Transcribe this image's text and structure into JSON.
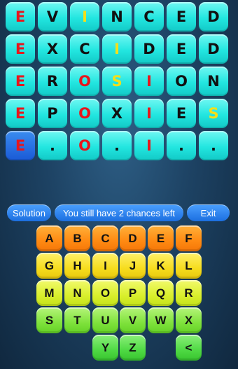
{
  "board": {
    "rows": [
      [
        {
          "ch": "E",
          "color": "red"
        },
        {
          "ch": "V",
          "color": "black"
        },
        {
          "ch": "I",
          "color": "yellow"
        },
        {
          "ch": "N",
          "color": "black"
        },
        {
          "ch": "C",
          "color": "black"
        },
        {
          "ch": "E",
          "color": "black"
        },
        {
          "ch": "D",
          "color": "black"
        }
      ],
      [
        {
          "ch": "E",
          "color": "red"
        },
        {
          "ch": "X",
          "color": "black"
        },
        {
          "ch": "C",
          "color": "black"
        },
        {
          "ch": "I",
          "color": "yellow"
        },
        {
          "ch": "D",
          "color": "black"
        },
        {
          "ch": "E",
          "color": "black"
        },
        {
          "ch": "D",
          "color": "black"
        }
      ],
      [
        {
          "ch": "E",
          "color": "red"
        },
        {
          "ch": "R",
          "color": "black"
        },
        {
          "ch": "O",
          "color": "red"
        },
        {
          "ch": "S",
          "color": "yellow"
        },
        {
          "ch": "I",
          "color": "red"
        },
        {
          "ch": "O",
          "color": "black"
        },
        {
          "ch": "N",
          "color": "black"
        }
      ],
      [
        {
          "ch": "E",
          "color": "red"
        },
        {
          "ch": "P",
          "color": "black"
        },
        {
          "ch": "O",
          "color": "red"
        },
        {
          "ch": "X",
          "color": "black"
        },
        {
          "ch": "I",
          "color": "red"
        },
        {
          "ch": "E",
          "color": "black"
        },
        {
          "ch": "S",
          "color": "yellow"
        }
      ],
      [
        {
          "ch": "E",
          "color": "red",
          "cursor": true
        },
        {
          "ch": ".",
          "color": "black"
        },
        {
          "ch": "O",
          "color": "red"
        },
        {
          "ch": ".",
          "color": "black"
        },
        {
          "ch": "I",
          "color": "red"
        },
        {
          "ch": ".",
          "color": "black"
        },
        {
          "ch": ".",
          "color": "black"
        }
      ]
    ]
  },
  "toolbar": {
    "solution_label": "Solution",
    "chances_text": "You still have 2 chances left",
    "exit_label": "Exit"
  },
  "keyboard": {
    "row1": [
      "A",
      "B",
      "C",
      "D",
      "E",
      "F"
    ],
    "row2": [
      "G",
      "H",
      "I",
      "J",
      "K",
      "L"
    ],
    "row3": [
      "M",
      "N",
      "O",
      "P",
      "Q",
      "R"
    ],
    "row4": [
      "S",
      "T",
      "U",
      "V",
      "W",
      "X"
    ],
    "row5": [
      "Y",
      "Z",
      "<"
    ]
  },
  "colors": {
    "red": "#e8161c",
    "yellow": "#f4df1a",
    "black": "#111111"
  }
}
